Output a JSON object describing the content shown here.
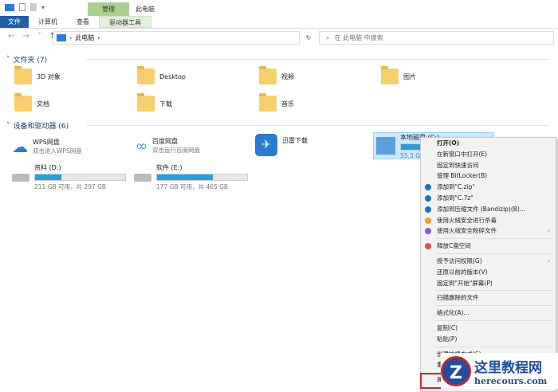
{
  "title": "此电脑",
  "ribbon": {
    "context_tab": "管理",
    "tabs": [
      "文件",
      "计算机",
      "查看",
      "驱动器工具"
    ]
  },
  "address": {
    "path": "此电脑",
    "search_placeholder": "在 此电脑 中搜索"
  },
  "folders_header": "文件夹 (7)",
  "folders": [
    "3D 对象",
    "Desktop",
    "视频",
    "图片",
    "文档",
    "下载",
    "音乐"
  ],
  "devices_header": "设备和驱动器 (6)",
  "devices": [
    {
      "name": "WPS网盘",
      "sub": "双击进入WPS网盘"
    },
    {
      "name": "百度网盘",
      "sub": "双击运行百度网盘"
    },
    {
      "name": "迅雷下载",
      "sub": ""
    },
    {
      "name": "本地磁盘 (C:)",
      "sub": "55.3 G",
      "used": 0.6
    },
    {
      "name": "资料 (D:)",
      "sub": "211 GB 可用，共 297 GB",
      "used": 0.29
    },
    {
      "name": "软件 (E:)",
      "sub": "177 GB 可用，共 465 GB",
      "used": 0.62
    }
  ],
  "menu": [
    {
      "label": "打开(O)",
      "bold": true
    },
    {
      "label": "在新窗口中打开(E)"
    },
    {
      "label": "固定到快速访问"
    },
    {
      "label": "管理 BitLocker(B)"
    },
    {
      "label": "添加到\"C.zip\"",
      "icon": "#1a73c8"
    },
    {
      "label": "添加到\"C.7z\"",
      "icon": "#1a73c8"
    },
    {
      "label": "添加到压缩文件 (Bandizip)(B)...",
      "icon": "#1a73c8"
    },
    {
      "label": "使用火绒安全进行杀毒",
      "icon": "#f0a030"
    },
    {
      "label": "使用火绒安全粉碎文件",
      "icon": "#8a5cd0",
      "arrow": true
    },
    {
      "sep": true
    },
    {
      "label": "释放C盘空间",
      "icon": "#e05050"
    },
    {
      "sep": true
    },
    {
      "label": "授予访问权限(G)",
      "arrow": true
    },
    {
      "label": "还原以前的版本(V)"
    },
    {
      "label": "固定到\"开始\"屏幕(P)"
    },
    {
      "sep": true
    },
    {
      "label": "扫描删除的文件"
    },
    {
      "sep": true
    },
    {
      "label": "格式化(A)..."
    },
    {
      "sep": true
    },
    {
      "label": "复制(C)"
    },
    {
      "label": "粘贴(P)"
    },
    {
      "sep": true
    },
    {
      "label": "创建快捷方式(S)"
    },
    {
      "label": "重命名(M)"
    },
    {
      "sep": true
    },
    {
      "label": "属性(R)"
    }
  ],
  "watermark": {
    "title": "这里教程网",
    "url": "herecours.com"
  }
}
